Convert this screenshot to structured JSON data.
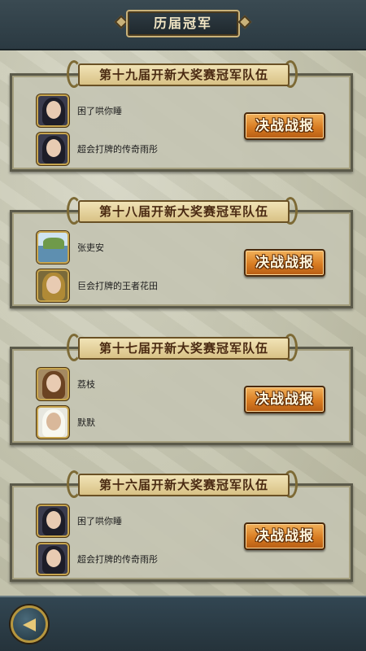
{
  "header": {
    "title": "历届冠军"
  },
  "entries": [
    {
      "title": "第十九届开新大奖赛冠军队伍",
      "members": [
        {
          "name": "困了哄你睡",
          "avatar": "dark-haired-hero-portrait"
        },
        {
          "name": "超会打牌的传奇雨彤",
          "avatar": "dark-haired-hero-portrait"
        }
      ],
      "button": "决战战报"
    },
    {
      "title": "第十八届开新大奖赛冠军队伍",
      "members": [
        {
          "name": "张吏安",
          "avatar": "lake-landscape-portrait"
        },
        {
          "name": "巨会打牌的王者花田",
          "avatar": "golden-armored-hero-portrait"
        }
      ],
      "button": "决战战报"
    },
    {
      "title": "第十七届开新大奖赛冠军队伍",
      "members": [
        {
          "name": "荔枝",
          "avatar": "brown-haired-heroine-portrait"
        },
        {
          "name": "默默",
          "avatar": "white-winged-hero-portrait"
        }
      ],
      "button": "决战战报"
    },
    {
      "title": "第十六届开新大奖赛冠军队伍",
      "members": [
        {
          "name": "困了哄你睡",
          "avatar": "dark-haired-hero-portrait"
        },
        {
          "name": "超会打牌的传奇雨彤",
          "avatar": "dark-haired-hero-portrait"
        }
      ],
      "button": "决战战报"
    }
  ],
  "footer": {
    "back_icon": "back-arrow-icon"
  }
}
